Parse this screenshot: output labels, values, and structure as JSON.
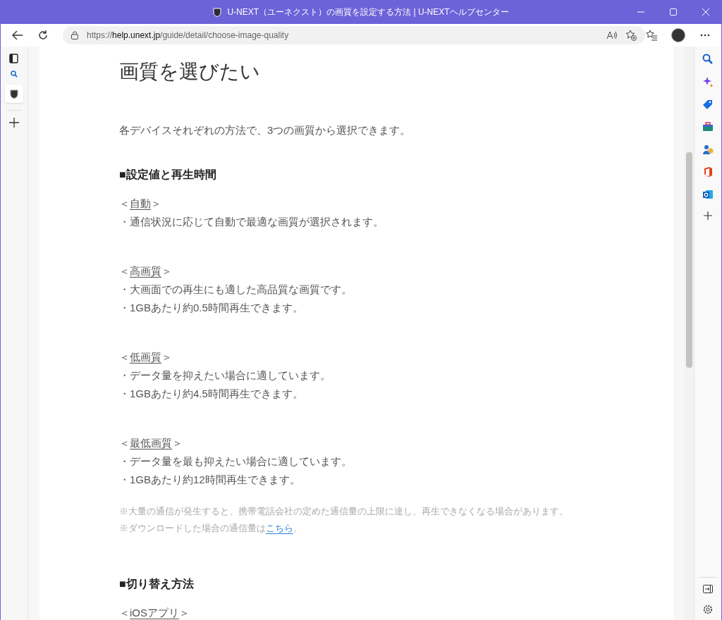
{
  "window": {
    "title": "U-NEXT（ユーネクスト）の画質を設定する方法 | U-NEXTヘルプセンター"
  },
  "address_bar": {
    "scheme": "https://",
    "host": "help.unext.jp",
    "path": "/guide/detail/choose-image-quality"
  },
  "article": {
    "title": "画質を選びたい",
    "intro": "各デバイスそれぞれの方法で、3つの画質から選択できます。",
    "sections": [
      {
        "heading": "■設定値と再生時間",
        "groups": [
          {
            "open": "＜",
            "label": "自動",
            "close": "＞",
            "lines": [
              "・通信状況に応じて自動で最適な画質が選択されます。"
            ]
          },
          {
            "open": "＜",
            "label": "高画質",
            "close": "＞",
            "lines": [
              "・大画面での再生にも適した高品質な画質です。",
              "・1GBあたり約0.5時間再生できます。"
            ]
          },
          {
            "open": "＜",
            "label": "低画質",
            "close": "＞",
            "lines": [
              "・データ量を抑えたい場合に適しています。",
              "・1GBあたり約4.5時間再生できます。"
            ]
          },
          {
            "open": "＜",
            "label": "最低画質",
            "close": "＞",
            "lines": [
              "・データ量を最も抑えたい場合に適しています。",
              "・1GBあたり約12時間再生できます。"
            ]
          }
        ],
        "notes": [
          {
            "text": "※大量の通信が発生すると、携帯電話会社の定めた通信量の上限に達し、再生できなくなる場合があります。"
          },
          {
            "text": "※ダウンロードした場合の通信量は",
            "link": "こちら",
            "after": "。"
          }
        ]
      },
      {
        "heading": "■切り替え方法",
        "groups": [
          {
            "open": "＜",
            "label": "iOSアプリ",
            "close": "＞"
          }
        ]
      }
    ]
  }
}
